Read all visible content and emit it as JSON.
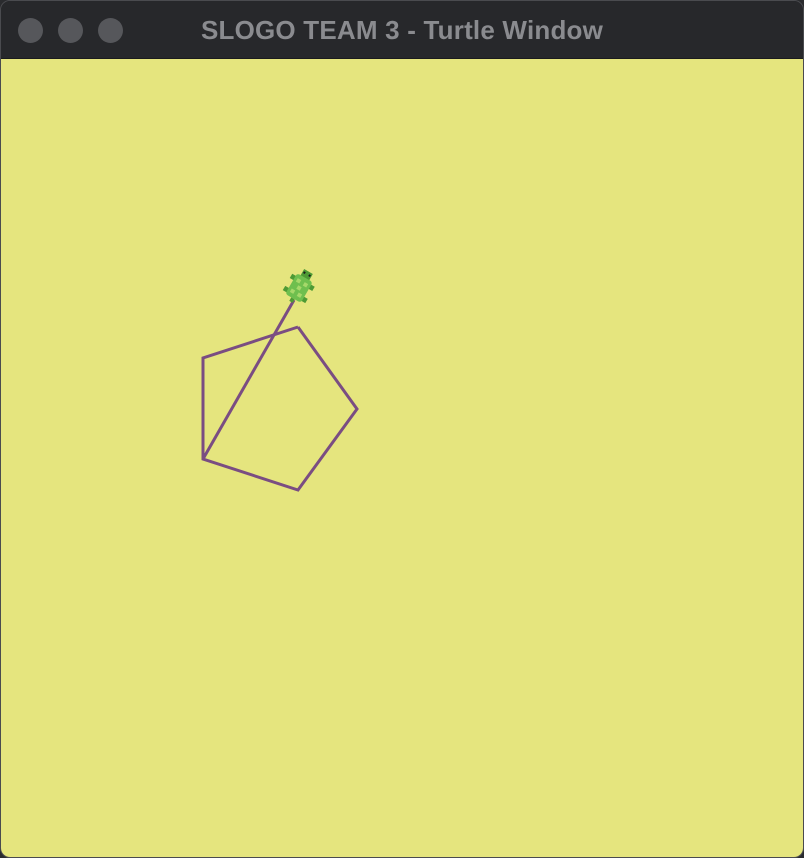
{
  "window": {
    "title": "SLOGO TEAM 3 - Turtle Window",
    "controls": [
      "close",
      "minimize",
      "zoom"
    ]
  },
  "canvas": {
    "background_color": "#e5e57e",
    "pen_color": "#7a4d82"
  },
  "turtle": {
    "icon": "turtle-icon",
    "color": "#6fbf4e"
  }
}
